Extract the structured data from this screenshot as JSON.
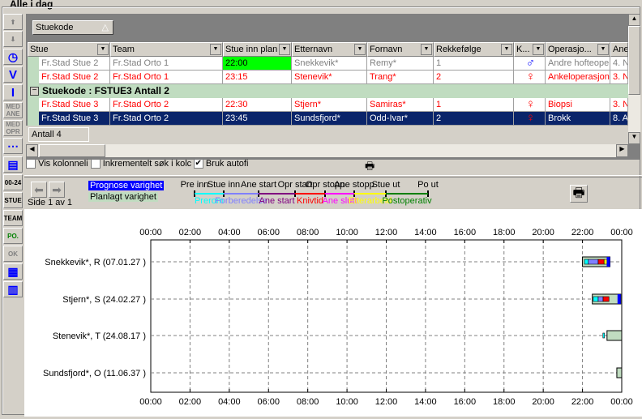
{
  "title": "Alle i dag",
  "toolbar": [
    {
      "icon": "arrow-up-icon"
    },
    {
      "icon": "arrow-down-icon"
    },
    {
      "icon": "clock-icon"
    },
    {
      "icon": "v-icon",
      "label": "V"
    },
    {
      "icon": "i-icon",
      "label": "I"
    },
    {
      "icon": "med-ane-icon",
      "label": "MED ANE"
    },
    {
      "icon": "med-opr-icon",
      "label": "MED OPR"
    },
    {
      "icon": "dashes-icon"
    },
    {
      "icon": "layout-icon"
    },
    {
      "icon": "clock24-icon",
      "label": "00-24"
    },
    {
      "icon": "stue-icon",
      "label": "STUE"
    },
    {
      "icon": "team-icon",
      "label": "TEAM"
    },
    {
      "icon": "po-icon",
      "label": "PO."
    },
    {
      "icon": "ok-icon",
      "label": "OK"
    },
    {
      "icon": "report-icon"
    },
    {
      "icon": "chart-icon"
    }
  ],
  "grid": {
    "group_by_button": "Stuekode",
    "columns": [
      "Stue",
      "Team",
      "Stue inn plan",
      "Etternavn",
      "Fornavn",
      "Rekkefølge",
      "K...",
      "Operasjo...",
      "Ane"
    ],
    "group_header": "Stuekode : FSTUE3 Antall 2",
    "rows": [
      {
        "stue": "Fr.Stad Stue 2",
        "team": "Fr.Stad Orto 1",
        "inn": "22:00",
        "etternavn": "Snekkevik*",
        "fornavn": "Remy*",
        "rekke": "1",
        "sex": "male",
        "op": "Andre hofteoper",
        "ane": "4. N",
        "style": "gray"
      },
      {
        "stue": "Fr.Stad Stue 2",
        "team": "Fr.Stad Orto 1",
        "inn": "23:15",
        "etternavn": "Stenevik*",
        "fornavn": "Trang*",
        "rekke": "2",
        "sex": "female",
        "op": "Ankeloperasjon",
        "ane": "3. N",
        "style": "red"
      },
      {
        "stue": "Fr.Stad Stue 3",
        "team": "Fr.Stad Orto 2",
        "inn": "22:30",
        "etternavn": "Stjern*",
        "fornavn": "Samiras*",
        "rekke": "1",
        "sex": "female",
        "op": "Biopsi",
        "ane": "3. N",
        "style": "red"
      },
      {
        "stue": "Fr.Stad Stue 3",
        "team": "Fr.Stad Orto 2",
        "inn": "23:45",
        "etternavn": "Sundsfjord*",
        "fornavn": "Odd-Ivar*",
        "rekke": "2",
        "sex": "female",
        "op": "Brokk",
        "ane": "8. A",
        "style": "selected"
      }
    ],
    "footer": "Antall 4"
  },
  "options": {
    "vis_kolonneli": "Vis kolonneli",
    "inkrementelt": "Inkrementelt søk i kolc",
    "bruk_autofi": "Bruk autofi",
    "bruk_autofi_checked": true
  },
  "legend": {
    "page": "Side 1 av 1",
    "prognose": "Prognose varighet",
    "planlagt": "Planlagt varighet",
    "milestones": [
      "Pre inn",
      "Stue inn",
      "Ane start",
      "Opr start",
      "Opr stopp",
      "Ane stopp",
      "Stue ut",
      "Po ut"
    ],
    "phases": [
      {
        "label": "Prerom",
        "color": "#00ffff"
      },
      {
        "label": "Forberedelse",
        "color": "#8080ff"
      },
      {
        "label": "Ane start",
        "color": "#800080"
      },
      {
        "label": "Knivtid",
        "color": "#ff0000"
      },
      {
        "label": "Ane slutt",
        "color": "#ff00ff"
      },
      {
        "label": "Etterarbeid",
        "color": "#ffff00"
      },
      {
        "label": "Postoperativ",
        "color": "#008000"
      }
    ]
  },
  "chart_data": {
    "type": "gantt",
    "ticks": [
      "00:00",
      "02:00",
      "04:00",
      "06:00",
      "08:00",
      "10:00",
      "12:00",
      "14:00",
      "16:00",
      "18:00",
      "20:00",
      "22:00",
      "00:00"
    ],
    "xlim_hours": [
      0,
      24
    ],
    "rows": [
      {
        "label": "Snekkevik*, R (07.01.27 )",
        "planned": [
          22.0,
          23.4
        ],
        "prognose_end": 23.4,
        "phases": [
          [
            22.1,
            22.3,
            "#00ffff"
          ],
          [
            22.3,
            22.8,
            "#8080ff"
          ],
          [
            22.8,
            23.1,
            "#ff0000"
          ],
          [
            23.1,
            23.25,
            "#ffff00"
          ]
        ]
      },
      {
        "label": "Stjern*, S (24.02.27 )",
        "planned": [
          22.5,
          23.95
        ],
        "prognose_end": 23.95,
        "phases": [
          [
            22.55,
            22.8,
            "#00ffff"
          ],
          [
            22.8,
            23.05,
            "#8080ff"
          ],
          [
            23.05,
            23.35,
            "#ff0000"
          ]
        ]
      },
      {
        "label": "Stenevik*, T (24.08.17 )",
        "planned": [
          23.25,
          24
        ],
        "marker": 23.0
      },
      {
        "label": "Sundsfjord*, O (11.06.37 )",
        "planned": [
          23.75,
          24
        ]
      }
    ]
  }
}
